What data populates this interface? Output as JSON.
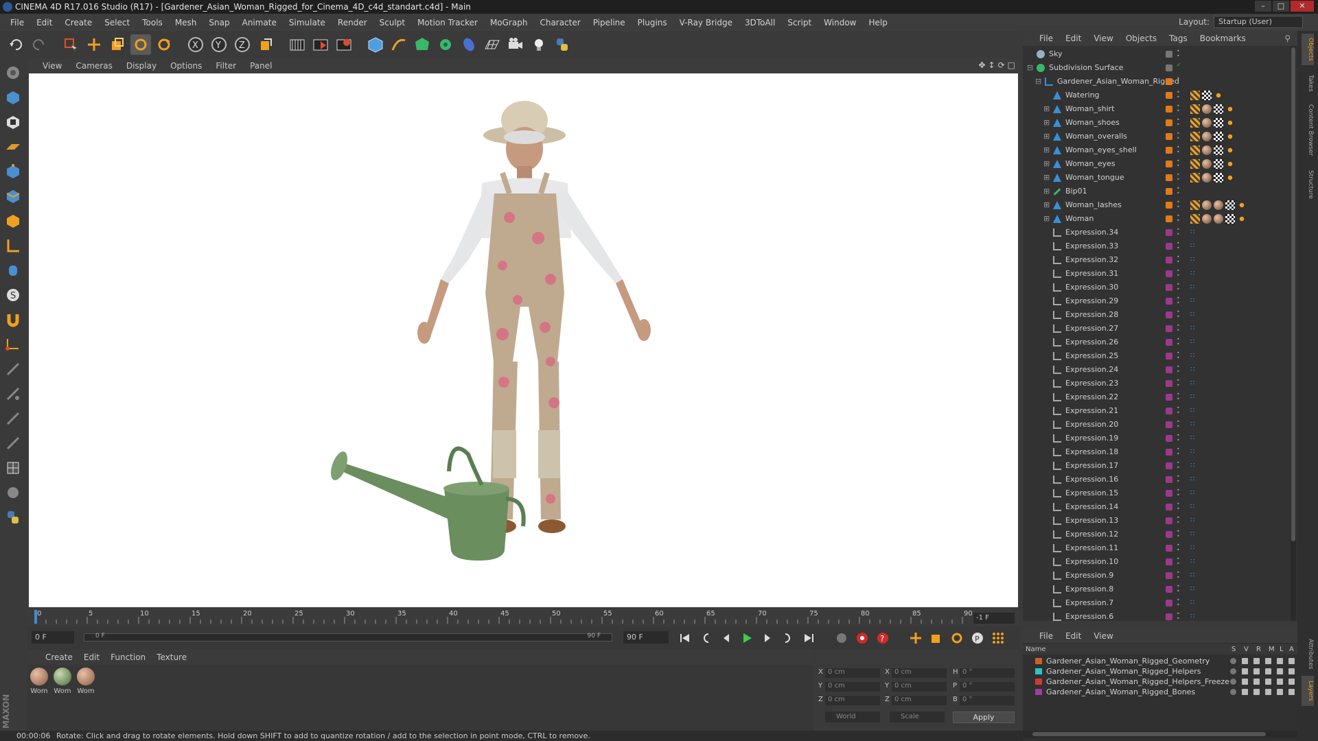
{
  "titlebar": {
    "title": "CINEMA 4D R17.016 Studio (R17) - [Gardener_Asian_Woman_Rigged_for_Cinema_4D_c4d_standart.c4d] - Main"
  },
  "menubar": {
    "items": [
      "File",
      "Edit",
      "Create",
      "Select",
      "Tools",
      "Mesh",
      "Snap",
      "Animate",
      "Simulate",
      "Render",
      "Sculpt",
      "Motion Tracker",
      "MoGraph",
      "Character",
      "Pipeline",
      "Plugins",
      "V-Ray Bridge",
      "3DToAll",
      "Script",
      "Window",
      "Help"
    ],
    "layout_label": "Layout:",
    "layout_value": "Startup (User)"
  },
  "viewport": {
    "menu": [
      "View",
      "Cameras",
      "Display",
      "Options",
      "Filter",
      "Panel"
    ]
  },
  "timeline": {
    "ticks": [
      "0",
      "5",
      "10",
      "15",
      "20",
      "25",
      "30",
      "35",
      "40",
      "45",
      "50",
      "55",
      "60",
      "65",
      "70",
      "75",
      "80",
      "85",
      "90"
    ],
    "current_frame_display": "-1 F"
  },
  "controls": {
    "start": "0 F",
    "range_start": "0 F",
    "range_end": "90 F",
    "end": "90 F"
  },
  "materials": {
    "menu": [
      "Create",
      "Edit",
      "Function",
      "Texture"
    ],
    "items": [
      {
        "label": "Wom"
      },
      {
        "label": "Wom"
      },
      {
        "label": "Wom"
      }
    ]
  },
  "coords": {
    "rows": [
      {
        "axis": "X",
        "pos": "0 cm",
        "axis2": "X",
        "size": "0 cm",
        "rot_axis": "H",
        "rot": "0 °"
      },
      {
        "axis": "Y",
        "pos": "0 cm",
        "axis2": "Y",
        "size": "0 cm",
        "rot_axis": "P",
        "rot": "0 °"
      },
      {
        "axis": "Z",
        "pos": "0 cm",
        "axis2": "Z",
        "size": "0 cm",
        "rot_axis": "B",
        "rot": "0 °"
      }
    ],
    "space": "World",
    "mode": "Scale",
    "apply": "Apply"
  },
  "status": {
    "time": "00:00:06",
    "message": "Rotate: Click and drag to rotate elements. Hold down SHIFT to add to quantize rotation / add to the selection in point mode, CTRL to remove."
  },
  "objects": {
    "menu": [
      "File",
      "Edit",
      "View",
      "Objects",
      "Tags",
      "Bookmarks"
    ],
    "items": [
      {
        "name": "Sky"
      },
      {
        "name": "Subdivision Surface"
      },
      {
        "name": "Gardener_Asian_Woman_Rigged"
      },
      {
        "name": "Watering"
      },
      {
        "name": "Woman_shirt"
      },
      {
        "name": "Woman_shoes"
      },
      {
        "name": "Woman_overalls"
      },
      {
        "name": "Woman_eyes_shell"
      },
      {
        "name": "Woman_eyes"
      },
      {
        "name": "Woman_tongue"
      },
      {
        "name": "Bip01"
      },
      {
        "name": "Woman_lashes"
      },
      {
        "name": "Woman"
      },
      {
        "name": "Expression.34"
      },
      {
        "name": "Expression.33"
      },
      {
        "name": "Expression.32"
      },
      {
        "name": "Expression.31"
      },
      {
        "name": "Expression.30"
      },
      {
        "name": "Expression.29"
      },
      {
        "name": "Expression.28"
      },
      {
        "name": "Expression.27"
      },
      {
        "name": "Expression.26"
      },
      {
        "name": "Expression.25"
      },
      {
        "name": "Expression.24"
      },
      {
        "name": "Expression.23"
      },
      {
        "name": "Expression.22"
      },
      {
        "name": "Expression.21"
      },
      {
        "name": "Expression.20"
      },
      {
        "name": "Expression.19"
      },
      {
        "name": "Expression.18"
      },
      {
        "name": "Expression.17"
      },
      {
        "name": "Expression.16"
      },
      {
        "name": "Expression.15"
      },
      {
        "name": "Expression.14"
      },
      {
        "name": "Expression.13"
      },
      {
        "name": "Expression.12"
      },
      {
        "name": "Expression.11"
      },
      {
        "name": "Expression.10"
      },
      {
        "name": "Expression.9"
      },
      {
        "name": "Expression.8"
      },
      {
        "name": "Expression.7"
      },
      {
        "name": "Expression.6"
      }
    ]
  },
  "layers": {
    "menu": [
      "File",
      "Edit",
      "View"
    ],
    "header": {
      "name": "Name",
      "cols": [
        "S",
        "V",
        "R",
        "M",
        "L",
        "A"
      ]
    },
    "items": [
      {
        "name": "Gardener_Asian_Woman_Rigged_Geometry",
        "color": "#c8622a"
      },
      {
        "name": "Gardener_Asian_Woman_Rigged_Helpers",
        "color": "#2ec4c4"
      },
      {
        "name": "Gardener_Asian_Woman_Rigged_Helpers_Freeze",
        "color": "#d03a3a"
      },
      {
        "name": "Gardener_Asian_Woman_Rigged_Bones",
        "color": "#a03ca0"
      }
    ]
  },
  "sidetabs": [
    "Objects",
    "Takes",
    "Content Browser",
    "Structure",
    "Attributes",
    "Layers"
  ],
  "colors": {
    "accent_orange": "#e07a1a",
    "axis_blue": "#3a8fd8",
    "expression_purple": "#9a3a8a"
  }
}
